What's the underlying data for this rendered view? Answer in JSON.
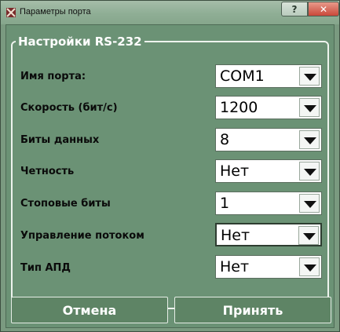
{
  "window": {
    "title": "Параметры порта",
    "help_glyph": "?",
    "close_glyph": "✕"
  },
  "group": {
    "title": "Настройки RS-232"
  },
  "fields": [
    {
      "label": "Имя порта:",
      "value": "COM1"
    },
    {
      "label": "Скорость (бит/с)",
      "value": "1200"
    },
    {
      "label": "Биты данных",
      "value": "8"
    },
    {
      "label": "Четность",
      "value": "Нет"
    },
    {
      "label": "Стоповые биты",
      "value": "1"
    },
    {
      "label": "Управление потоком",
      "value": "Нет"
    },
    {
      "label": "Тип АПД",
      "value": "Нет"
    }
  ],
  "buttons": {
    "cancel": "Отмена",
    "accept": "Принять"
  },
  "colors": {
    "window_bg": "#6b9275",
    "group_border": "#eef3ee",
    "close_button": "#c9483a"
  }
}
